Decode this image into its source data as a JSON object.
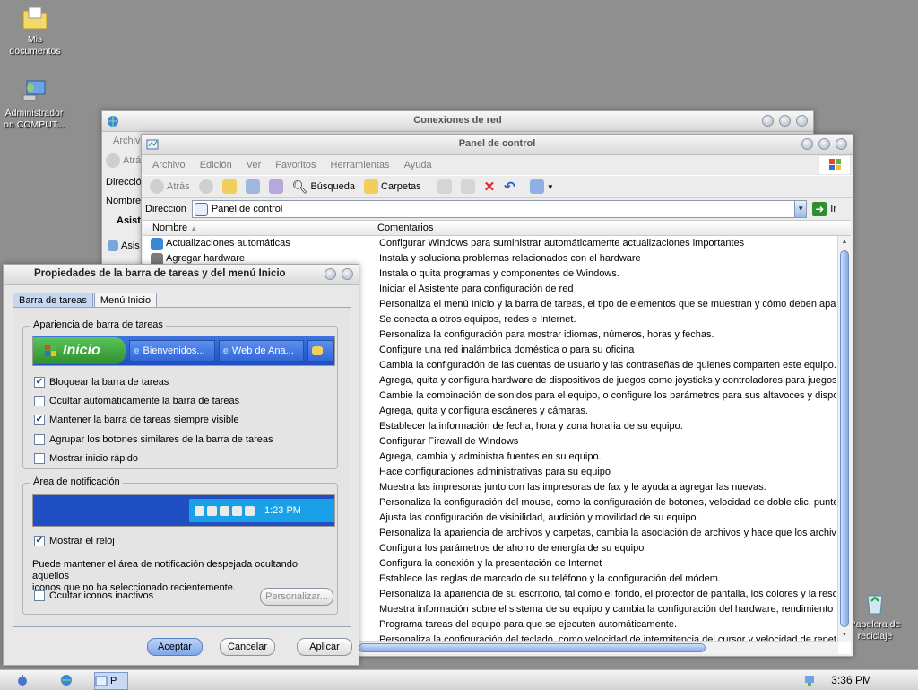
{
  "desktop": {
    "icons": [
      {
        "label_line1": "Mis",
        "label_line2": "documentos",
        "icon": "folder-documents-icon"
      },
      {
        "label_line1": "Administrador",
        "label_line2": "on COMPUT...",
        "icon": "computer-network-icon"
      },
      {
        "label_line1": "Papelera de",
        "label_line2": "reciclaje",
        "icon": "recycle-bin-icon"
      }
    ]
  },
  "net_window": {
    "title": "Conexiones de red",
    "menu_first": "Archivo",
    "back_label": "Atrás",
    "address_label": "Direcció",
    "col_first": "Nombre",
    "section_label": "Asist",
    "items": [
      "Asis",
      "Asis"
    ]
  },
  "control_panel": {
    "title": "Panel de control",
    "menu": [
      "Archivo",
      "Edición",
      "Ver",
      "Favoritos",
      "Herramientas",
      "Ayuda"
    ],
    "toolbar": {
      "back": "Atrás",
      "search": "Búsqueda",
      "folders": "Carpetas"
    },
    "address_label": "Dirección",
    "address_value": "Panel de control",
    "go_label": "Ir",
    "columns": {
      "name": "Nombre",
      "comments": "Comentarios"
    },
    "rows": [
      {
        "name": "Actualizaciones automáticas",
        "comment": "Configurar Windows para suministrar automáticamente actualizaciones importantes"
      },
      {
        "name": "Agregar hardware",
        "comment": "Instala y soluciona problemas relacionados con el hardware"
      },
      {
        "name": "",
        "comment": "Instala o quita programas y componentes de Windows."
      },
      {
        "name": "",
        "comment": "Iniciar el Asistente para configuración de red"
      },
      {
        "name": "",
        "comment": "Personaliza el menú Inicio y la barra de tareas, el tipo de elementos que se muestran y cómo deben aparecer"
      },
      {
        "name": "",
        "comment": "Se conecta a otros equipos, redes e Internet."
      },
      {
        "name": "",
        "comment": "Personaliza la configuración para mostrar idiomas, números, horas y fechas."
      },
      {
        "name": "",
        "comment": "Configure una red inalámbrica doméstica o para su oficina"
      },
      {
        "name": "",
        "comment": "Cambia la configuración de las cuentas de usuario y las contraseñas de quienes comparten este equipo."
      },
      {
        "name": "",
        "comment": "Agrega, quita y configura hardware de dispositivos de juegos como joysticks y controladores para juegos."
      },
      {
        "name": "",
        "comment": "Cambie la combinación de sonidos para el  equipo, o configure los parámetros para sus altavoces y dispositivos"
      },
      {
        "name": "",
        "comment": "Agrega, quita y configura escáneres y cámaras."
      },
      {
        "name": "",
        "comment": "Establecer la información de fecha, hora y zona horaria de su equipo."
      },
      {
        "name": "",
        "comment": "Configurar Firewall de Windows"
      },
      {
        "name": "",
        "comment": "Agrega, cambia y administra fuentes en su equipo."
      },
      {
        "name": "",
        "comment": "Hace configuraciones administrativas para su equipo"
      },
      {
        "name": "",
        "comment": "Muestra las impresoras junto con las impresoras de fax y le ayuda a agregar las nuevas."
      },
      {
        "name": "",
        "comment": "Personaliza la configuración del mouse, como la configuración de botones, velocidad de doble clic, punteros"
      },
      {
        "name": "",
        "comment": "Ajusta las configuración de visibilidad, audición y movilidad de su equipo."
      },
      {
        "name": "",
        "comment": "Personaliza la apariencia de archivos y carpetas, cambia la asociación de archivos y hace que los archivos"
      },
      {
        "name": "",
        "comment": "Configura los parámetros de ahorro de energía de su equipo"
      },
      {
        "name": "",
        "comment": "Configura la conexión y la presentación de Internet"
      },
      {
        "name": "",
        "comment": "Establece las reglas de marcado de su teléfono y la configuración del módem."
      },
      {
        "name": "",
        "comment": "Personaliza la apariencia de su escritorio, tal como el fondo, el protector de pantalla, los colores y la resolución"
      },
      {
        "name": "",
        "comment": "Muestra información sobre el sistema de su equipo y cambia la configuración del hardware, rendimiento y actualizaciones"
      },
      {
        "name": "",
        "comment": "Programa tareas del equipo para que se ejecuten automáticamente."
      },
      {
        "name": "",
        "comment": "Personaliza la configuración del teclado, como velocidad de intermitencia del cursor y velocidad de repetición"
      }
    ]
  },
  "dialog": {
    "title": "Propiedades de la barra de tareas y del menú Inicio",
    "tabs": [
      "Barra de tareas",
      "Menú Inicio"
    ],
    "appearance_group": "Apariencia de barra de tareas",
    "preview": {
      "start_label": "Inicio",
      "task1": "Bienvenidos...",
      "task2": "Web de Ana..."
    },
    "options": [
      {
        "label": "Bloquear la barra de tareas",
        "checked": true
      },
      {
        "label": "Ocultar automáticamente la barra de tareas",
        "checked": false
      },
      {
        "label": "Mantener la barra de tareas siempre visible",
        "checked": true
      },
      {
        "label": "Agrupar los botones similares de la barra de tareas",
        "checked": false
      },
      {
        "label": "Mostrar inicio rápido",
        "checked": false
      }
    ],
    "notification_group": "Área de notificación",
    "tray_time": "1:23 PM",
    "show_clock": {
      "label": "Mostrar el reloj",
      "checked": true
    },
    "note_line1": "Puede mantener el área de notificación despejada ocultando aquellos",
    "note_line2": "iconos que no ha seleccionado recientemente.",
    "hide_inactive": {
      "label": "Ocultar iconos inactivos",
      "checked": false
    },
    "customize_button": "Personalizar...",
    "buttons": {
      "accept": "Aceptar",
      "cancel": "Cancelar",
      "apply": "Aplicar"
    }
  },
  "taskbar": {
    "task_label": "P",
    "clock": "3:36 PM"
  },
  "colors": {
    "accent": "#3f6fd6",
    "start_green": "#3aa23a",
    "tray_blue": "#1aa0e6"
  }
}
